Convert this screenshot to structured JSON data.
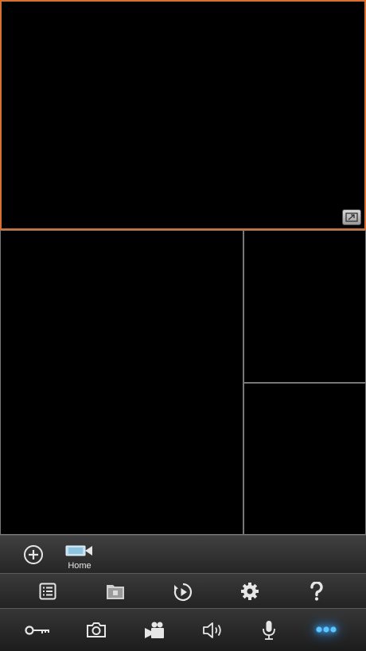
{
  "device": {
    "name": "Home"
  },
  "icons": {
    "fullscreen": "expand-window-icon",
    "add_device": "add-circle-icon",
    "camera_device": "camera-device-icon",
    "device_list": "list-icon",
    "gallery": "gallery-icon",
    "playback": "playback-icon",
    "settings": "gear-icon",
    "help": "help-icon",
    "unlock": "key-icon",
    "snapshot": "camera-icon",
    "record": "video-record-icon",
    "audio": "speaker-icon",
    "talk": "microphone-icon",
    "more": "more-dots-icon"
  },
  "colors": {
    "active_tile_border": "#d9702f",
    "tile_border": "#777777",
    "icon": "#e6e6e6",
    "more_glow": "#3ab0ff"
  }
}
